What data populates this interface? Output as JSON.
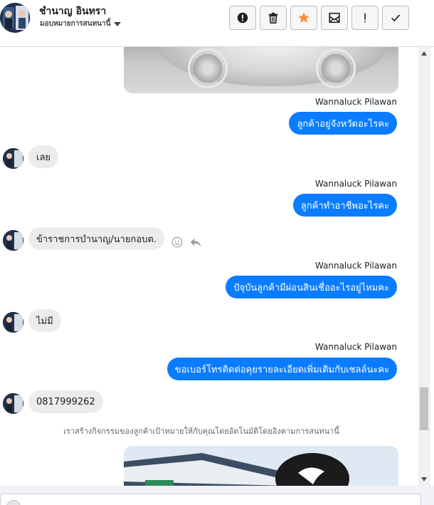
{
  "header": {
    "contact_name": "ชำนาญ อินทรา",
    "assign_label": "มอบหมายการสนทนานี้",
    "toolbar": [
      {
        "name": "spam-button",
        "icon": "exclamation-circle-icon"
      },
      {
        "name": "delete-button",
        "icon": "trash-icon"
      },
      {
        "name": "star-button",
        "icon": "star-icon"
      },
      {
        "name": "mark-unread-button",
        "icon": "envelope-icon"
      },
      {
        "name": "follow-up-button",
        "icon": "exclamation-icon"
      },
      {
        "name": "mark-done-button",
        "icon": "check-icon"
      }
    ],
    "star_color": "#f7923a"
  },
  "messages": [
    {
      "type": "outgoing",
      "sender": "Wannaluck Pilawan",
      "text": "ลูกค้าอยู่จังหวัดอะไรคะ"
    },
    {
      "type": "incoming",
      "text": "เลย"
    },
    {
      "type": "outgoing",
      "sender": "Wannaluck Pilawan",
      "text": "ลูกค้าทำอาชีพอะไรคะ"
    },
    {
      "type": "incoming",
      "text": "ข้าราชการบำนาญ/นายกอบต."
    },
    {
      "type": "outgoing",
      "sender": "Wannaluck Pilawan",
      "text": "ปัจุบันลูกค้ามีผ่อนสินเชื่ออะไรอยู่ไหมคะ"
    },
    {
      "type": "incoming",
      "text": "ไม่มี"
    },
    {
      "type": "outgoing",
      "sender": "Wannaluck Pilawan",
      "text": "ขอเบอร์โทรติดต่อคุยรายละเอียดเพิ่มเติมกับเซลล์นะคะ"
    },
    {
      "type": "incoming",
      "text": "0817999262"
    }
  ],
  "system_note": "เราสร้างกิจกรรมของลูกค้าเป้าหมายให้กับคุณโดยอัตโนมัติโดยอิงตามการสนทนานี้",
  "colors": {
    "outgoing_bubble": "#0a7cff",
    "incoming_bubble": "#ebecee"
  }
}
